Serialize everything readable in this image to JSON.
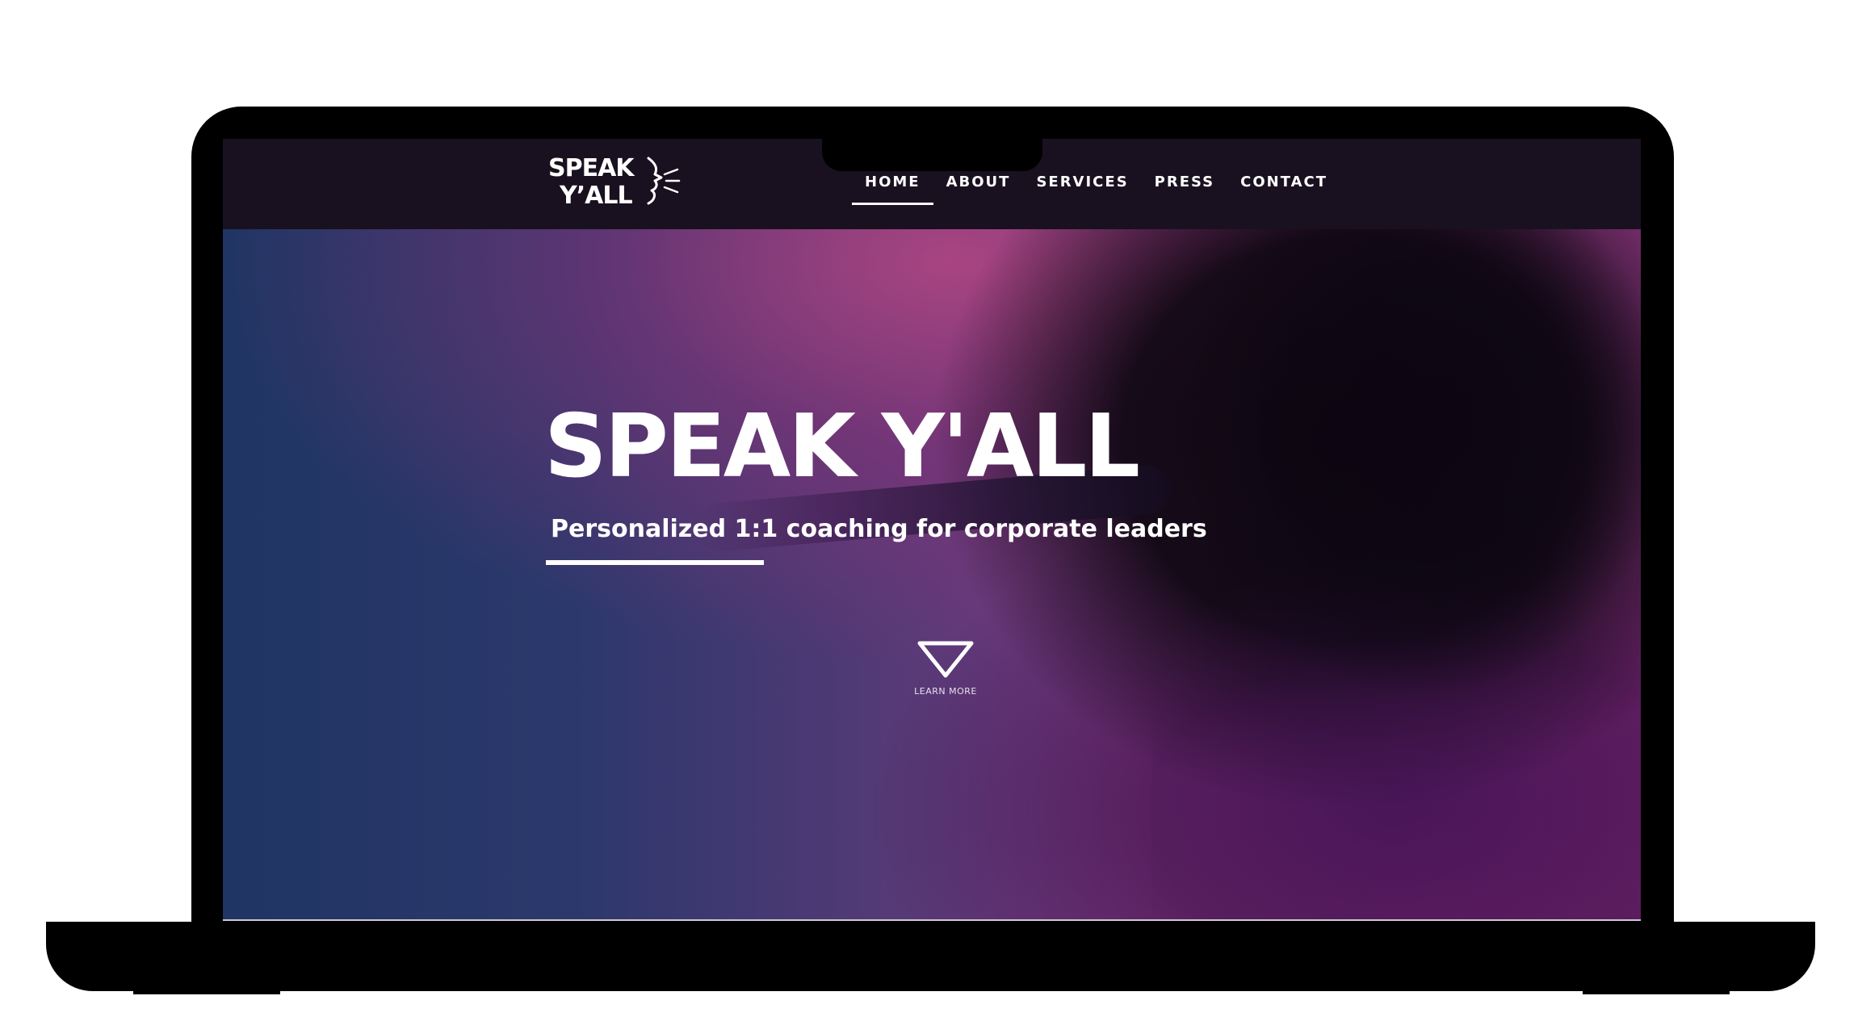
{
  "brand": {
    "logo_line1": "SPEAK",
    "logo_line2": "Y’ALL"
  },
  "nav": {
    "items": [
      {
        "label": "HOME",
        "active": true
      },
      {
        "label": "ABOUT",
        "active": false
      },
      {
        "label": "SERVICES",
        "active": false
      },
      {
        "label": "PRESS",
        "active": false
      },
      {
        "label": "CONTACT",
        "active": false
      }
    ]
  },
  "hero": {
    "title": "SPEAK Y'ALL",
    "subtitle": "Personalized 1:1 coaching for corporate leaders",
    "cta_label": "LEARN MORE",
    "cta_icon": "triangle-down-icon"
  },
  "scroll_top": {
    "icon": "chevron-up-icon",
    "color": "#c0555f"
  },
  "colors": {
    "navbar": "#1a1120",
    "hero_left": "#1f3563",
    "hero_right": "#9b3f8a",
    "text": "#ffffff"
  }
}
